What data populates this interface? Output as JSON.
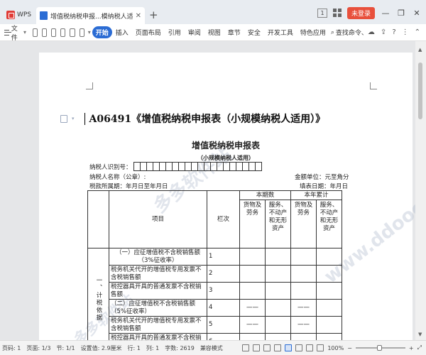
{
  "app": {
    "name": "WPS",
    "doc_tab_title": "增值税纳税申报...模纳税人适用)",
    "login_label": "未登录",
    "badge_num": "1"
  },
  "toolbar": {
    "file_label": "文件",
    "tabs": [
      "开始",
      "插入",
      "页面布局",
      "引用",
      "审阅",
      "视图",
      "章节",
      "安全",
      "开发工具",
      "特色应用"
    ],
    "active_tab": "开始",
    "search_cmd": "查找命令、"
  },
  "document": {
    "heading": "A06491《增值税纳税申报表（小规模纳税人适用）》",
    "form_title": "增值税纳税申报表",
    "form_subtitle": "（小规模纳税人适用）",
    "taxid_label": "纳税人识别号：",
    "taxpayer_label": "纳税人名称（公章）:",
    "unit_label": "金额单位：元至角分",
    "period_label": "税款所属期：年月日至年月日",
    "filldate_label": "填表日期：年月日",
    "watermarks": [
      "多多软件站",
      "www.ddooo.com",
      "多多软件站"
    ],
    "table": {
      "item_header": "项目",
      "col_header": "栏次",
      "current_period": "本期数",
      "year_cumulative": "本年累计",
      "sub_goods": "货物及劳务",
      "sub_services": "服务、不动产和无形资产",
      "category": "一、计税依据",
      "rows": [
        {
          "item": "（一）应征增值税不含税销售额（3%征收率）",
          "line": "1",
          "v1": "",
          "v2": "",
          "v3": "",
          "v4": ""
        },
        {
          "item": "税务机关代开的增值税专用发票不含税销售额",
          "line": "2",
          "v1": "",
          "v2": "",
          "v3": "",
          "v4": ""
        },
        {
          "item": "税控器具开具的普通发票不含税销售额",
          "line": "3",
          "v1": "",
          "v2": "",
          "v3": "",
          "v4": ""
        },
        {
          "item": "（二）应征增值税不含税销售额（5%征收率）",
          "line": "4",
          "v1": "——",
          "v2": "",
          "v3": "——",
          "v4": ""
        },
        {
          "item": "税务机关代开的增值税专用发票不含税销售额",
          "line": "5",
          "v1": "——",
          "v2": "",
          "v3": "——",
          "v4": ""
        },
        {
          "item": "税控器具开具的普通发票不含税销售额",
          "line": "6",
          "v1": "——",
          "v2": "",
          "v3": "——",
          "v4": ""
        }
      ]
    }
  },
  "status": {
    "page_num": "页码: 1",
    "page": "页面: 1/3",
    "section": "节: 1/1",
    "position": "设置值: 2.9厘米",
    "line": "行: 1",
    "column": "列: 1",
    "words": "字数: 2619",
    "mode": "兼容模式",
    "zoom": "100%"
  }
}
